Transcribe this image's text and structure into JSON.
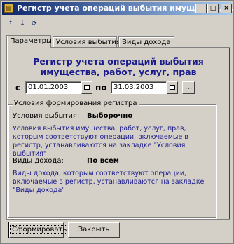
{
  "window": {
    "title": "Регистр учета операций выбытия имущества, ...",
    "controls": {
      "minimize": "_",
      "maximize": "□",
      "close": "×"
    }
  },
  "toolbar": {
    "items": [
      {
        "name": "up-arrow-icon",
        "glyph": "⇡"
      },
      {
        "name": "down-arrow-icon",
        "glyph": "⇣"
      },
      {
        "name": "refresh-icon",
        "glyph": "⟳"
      }
    ]
  },
  "tabs": [
    {
      "label": "Параметры",
      "active": true
    },
    {
      "label": "Условия выбытия",
      "active": false
    },
    {
      "label": "Виды дохода",
      "active": false
    }
  ],
  "params": {
    "heading_line1": "Регистр учета операций выбытия",
    "heading_line2": "имущества, работ, услуг, прав",
    "from_label": "с",
    "from_value": "01.01.2003",
    "to_label": "по",
    "to_value": "31.03.2003",
    "dots_label": "..."
  },
  "group": {
    "title": "Условия формирования регистра",
    "conditions_label": "Условия выбытия:",
    "conditions_value": "Выборочно",
    "conditions_note": "Условия выбытия имущества, работ, услуг, прав, которым соответствуют операции, включаемые в регистр, устанавливаются на закладке \"Условия выбытия\"",
    "income_label": "Виды дохода:",
    "income_value": "По всем",
    "income_note": "Виды дохода, которым соответствуют операции, включаемые в регистр, устанавливаются на закладке \"Виды дохода\""
  },
  "buttons": {
    "generate": "Сформировать",
    "close": "Закрыть"
  }
}
